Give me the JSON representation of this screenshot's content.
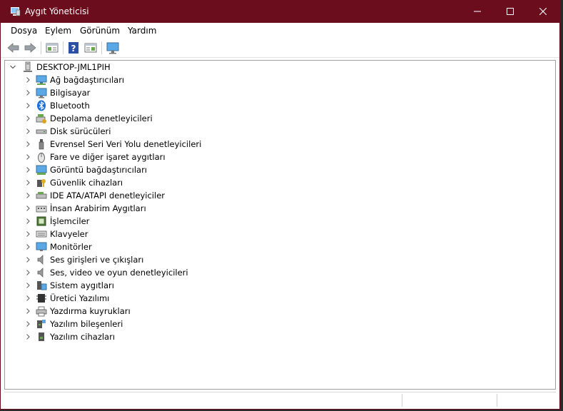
{
  "window": {
    "title": "Aygıt Yöneticisi",
    "title_color": "#6b0d1d"
  },
  "menu": {
    "items": [
      "Dosya",
      "Eylem",
      "Görünüm",
      "Yardım"
    ]
  },
  "toolbar": {
    "buttons": [
      "back-arrow-icon",
      "forward-arrow-icon",
      "properties-icon",
      "help-icon",
      "action-icon",
      "monitor-scan-icon"
    ]
  },
  "tree": {
    "root": "DESKTOP-JML1PIH",
    "items": [
      {
        "label": "Ağ bağdaştırıcıları",
        "icon": "network-adapter-icon"
      },
      {
        "label": "Bilgisayar",
        "icon": "computer-icon"
      },
      {
        "label": "Bluetooth",
        "icon": "bluetooth-icon"
      },
      {
        "label": "Depolama denetleyicileri",
        "icon": "storage-controller-icon"
      },
      {
        "label": "Disk sürücüleri",
        "icon": "disk-drive-icon"
      },
      {
        "label": "Evrensel Seri Veri Yolu denetleyicileri",
        "icon": "usb-icon"
      },
      {
        "label": "Fare ve diğer işaret aygıtları",
        "icon": "mouse-icon"
      },
      {
        "label": "Görüntü bağdaştırıcıları",
        "icon": "display-adapter-icon"
      },
      {
        "label": "Güvenlik cihazları",
        "icon": "security-device-icon"
      },
      {
        "label": "IDE ATA/ATAPI denetleyiciler",
        "icon": "ide-controller-icon"
      },
      {
        "label": "İnsan Arabirim Aygıtları",
        "icon": "hid-icon"
      },
      {
        "label": "İşlemciler",
        "icon": "processor-icon"
      },
      {
        "label": "Klavyeler",
        "icon": "keyboard-icon"
      },
      {
        "label": "Monitörler",
        "icon": "monitor-icon"
      },
      {
        "label": "Ses girişleri ve çıkışları",
        "icon": "speaker-icon"
      },
      {
        "label": "Ses, video ve oyun denetleyicileri",
        "icon": "sound-controller-icon"
      },
      {
        "label": "Sistem aygıtları",
        "icon": "system-device-icon"
      },
      {
        "label": "Üretici Yazılımı",
        "icon": "firmware-icon"
      },
      {
        "label": "Yazdırma kuyrukları",
        "icon": "printer-icon"
      },
      {
        "label": "Yazılım bileşenleri",
        "icon": "software-component-icon"
      },
      {
        "label": "Yazılım cihazları",
        "icon": "software-device-icon"
      }
    ]
  }
}
